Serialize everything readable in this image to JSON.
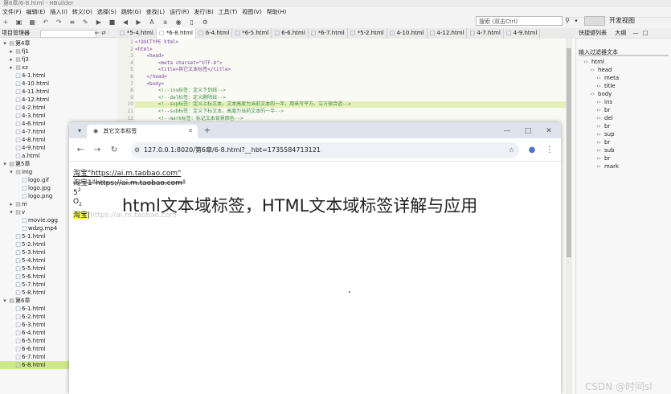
{
  "ide": {
    "title": "第6章/6-8.html - HBuilder",
    "menu": [
      "文件(F)",
      "编辑(E)",
      "插入(I)",
      "转义(O)",
      "选择(S)",
      "跳转(G)",
      "查找(L)",
      "运行(R)",
      "发行(B)",
      "工具(T)",
      "视图(V)",
      "帮助(H)"
    ],
    "search_placeholder": "搜索 (双击Ctrl)",
    "view_toggle": "开发视图",
    "view_toggle_btn": "",
    "project_panel_title": "项目管理器",
    "outline_panel_title": "快捷键列表",
    "outline_panel_tab2": "大纲"
  },
  "tree": [
    {
      "label": "第4章",
      "kind": "folder",
      "level": 0,
      "arrow": "▾"
    },
    {
      "label": "fj1",
      "kind": "folder",
      "level": 1,
      "arrow": "▸"
    },
    {
      "label": "fj3",
      "kind": "folder",
      "level": 1,
      "arrow": "▸"
    },
    {
      "label": "xz",
      "kind": "folder",
      "level": 1,
      "arrow": "▸"
    },
    {
      "label": "4-1.html",
      "kind": "file",
      "level": 1,
      "arrow": ""
    },
    {
      "label": "4-10.html",
      "kind": "file",
      "level": 1,
      "arrow": ""
    },
    {
      "label": "4-11.html",
      "kind": "file",
      "level": 1,
      "arrow": ""
    },
    {
      "label": "4-12.html",
      "kind": "file",
      "level": 1,
      "arrow": ""
    },
    {
      "label": "4-2.html",
      "kind": "file",
      "level": 1,
      "arrow": ""
    },
    {
      "label": "4-3.html",
      "kind": "file",
      "level": 1,
      "arrow": ""
    },
    {
      "label": "4-6.html",
      "kind": "file",
      "level": 1,
      "arrow": ""
    },
    {
      "label": "4-7.html",
      "kind": "file",
      "level": 1,
      "arrow": ""
    },
    {
      "label": "4-8.html",
      "kind": "file",
      "level": 1,
      "arrow": ""
    },
    {
      "label": "4-9.html",
      "kind": "file",
      "level": 1,
      "arrow": ""
    },
    {
      "label": "a.html",
      "kind": "file",
      "level": 1,
      "arrow": ""
    },
    {
      "label": "第5章",
      "kind": "folder",
      "level": 0,
      "arrow": "▾"
    },
    {
      "label": "img",
      "kind": "folder",
      "level": 1,
      "arrow": "▾"
    },
    {
      "label": "logo.gif",
      "kind": "file",
      "level": 2,
      "arrow": ""
    },
    {
      "label": "logo.jpg",
      "kind": "file",
      "level": 2,
      "arrow": ""
    },
    {
      "label": "logo.png",
      "kind": "file",
      "level": 2,
      "arrow": ""
    },
    {
      "label": "m",
      "kind": "folder",
      "level": 1,
      "arrow": "▸"
    },
    {
      "label": "v",
      "kind": "folder",
      "level": 1,
      "arrow": "▾"
    },
    {
      "label": "movie.ogg",
      "kind": "file",
      "level": 2,
      "arrow": ""
    },
    {
      "label": "wdzg.mp4",
      "kind": "file",
      "level": 2,
      "arrow": ""
    },
    {
      "label": "5-1.html",
      "kind": "file",
      "level": 1,
      "arrow": ""
    },
    {
      "label": "5-2.html",
      "kind": "file",
      "level": 1,
      "arrow": ""
    },
    {
      "label": "5-3.html",
      "kind": "file",
      "level": 1,
      "arrow": ""
    },
    {
      "label": "5-4.html",
      "kind": "file",
      "level": 1,
      "arrow": ""
    },
    {
      "label": "5-5.html",
      "kind": "file",
      "level": 1,
      "arrow": ""
    },
    {
      "label": "5-6.html",
      "kind": "file",
      "level": 1,
      "arrow": ""
    },
    {
      "label": "5-7.html",
      "kind": "file",
      "level": 1,
      "arrow": ""
    },
    {
      "label": "5-8.html",
      "kind": "file",
      "level": 1,
      "arrow": ""
    },
    {
      "label": "第6章",
      "kind": "folder",
      "level": 0,
      "arrow": "▾"
    },
    {
      "label": "6-1.html",
      "kind": "file",
      "level": 1,
      "arrow": ""
    },
    {
      "label": "6-2.html",
      "kind": "file",
      "level": 1,
      "arrow": ""
    },
    {
      "label": "6-3.html",
      "kind": "file",
      "level": 1,
      "arrow": ""
    },
    {
      "label": "6-4.html",
      "kind": "file",
      "level": 1,
      "arrow": ""
    },
    {
      "label": "6-5.html",
      "kind": "file",
      "level": 1,
      "arrow": ""
    },
    {
      "label": "6-6.html",
      "kind": "file",
      "level": 1,
      "arrow": ""
    },
    {
      "label": "6-7.html",
      "kind": "file",
      "level": 1,
      "arrow": ""
    },
    {
      "label": "6-8.html",
      "kind": "file",
      "level": 1,
      "arrow": "",
      "selected": true
    }
  ],
  "tabs": [
    {
      "label": "*5-4.html"
    },
    {
      "label": "*6-8.html",
      "active": true
    },
    {
      "label": "6-4.html"
    },
    {
      "label": "*6-5.html"
    },
    {
      "label": "6-6.html"
    },
    {
      "label": "*6-7.html"
    },
    {
      "label": "*5-2.html"
    },
    {
      "label": "4-10.html"
    },
    {
      "label": "4-12.html"
    },
    {
      "label": "4-7.html"
    },
    {
      "label": "4-9.html"
    }
  ],
  "code": [
    {
      "n": "1",
      "t": "<!DOCTYPE html>",
      "c": "#7a3e9d"
    },
    {
      "n": "2",
      "t": "<html>",
      "c": "#7a3e9d"
    },
    {
      "n": "3",
      "t": "    <head>",
      "c": "#7a3e9d"
    },
    {
      "n": "4",
      "t": "        <meta charset=\"UTF-8\">",
      "c": "#7a3e9d"
    },
    {
      "n": "5",
      "t": "        <title>其它文本标签</title>",
      "c": "#7a3e9d"
    },
    {
      "n": "6",
      "t": "    </head>",
      "c": "#7a3e9d"
    },
    {
      "n": "7",
      "t": "    <body>",
      "c": "#7a3e9d"
    },
    {
      "n": "8",
      "t": "        <!--ins标签：定义下划线-->",
      "c": "#3f8f3f"
    },
    {
      "n": "9",
      "t": "        <!--del标签：定义删除线-->",
      "c": "#3f8f3f"
    },
    {
      "n": "10",
      "t": "        <!--sup标签：定义上标文本，文本高度为当前文本的一半，用来写平方、立方很合适-->",
      "c": "#3f8f3f",
      "highlight": true
    },
    {
      "n": "11",
      "t": "        <!--sub标签：定义下标文本，高度为当前文本的一半-->",
      "c": "#3f8f3f"
    },
    {
      "n": "12",
      "t": "        <!--mark标签：标记文本背景颜色-->",
      "c": "#3f8f3f"
    }
  ],
  "outline": {
    "title": "输入过滤器文本",
    "items": [
      {
        "label": "html",
        "level": 0
      },
      {
        "label": "head",
        "level": 1
      },
      {
        "label": "meta",
        "level": 2
      },
      {
        "label": "title",
        "level": 2
      },
      {
        "label": "body",
        "level": 1
      },
      {
        "label": "ins",
        "level": 2
      },
      {
        "label": "br",
        "level": 2
      },
      {
        "label": "del",
        "level": 2
      },
      {
        "label": "br",
        "level": 2
      },
      {
        "label": "sup",
        "level": 2
      },
      {
        "label": "br",
        "level": 2
      },
      {
        "label": "sub",
        "level": 2
      },
      {
        "label": "br",
        "level": 2
      },
      {
        "label": "mark",
        "level": 2
      }
    ]
  },
  "browser": {
    "tab_title": "其它文本标签",
    "url": "127.0.0.1:8020/第6章/6-8.html?__hbt=1735584713121",
    "content": {
      "ins_text": "淘宝\"https://ai.m.taobao.com\"",
      "del_text": "淘宝1\"https://ai.m.taobao.com\"",
      "sup_base": "5",
      "sup_exp": "2",
      "sub_base": "O",
      "sub_idx": "2",
      "mark_text": "淘宝",
      "mark_cursor": "|",
      "mark_hint": "https://ai.m.taobao.com"
    }
  },
  "overlay_title": "html文本域标签，HTML文本域标签详解与应用",
  "watermark": "CSDN @时间sl"
}
